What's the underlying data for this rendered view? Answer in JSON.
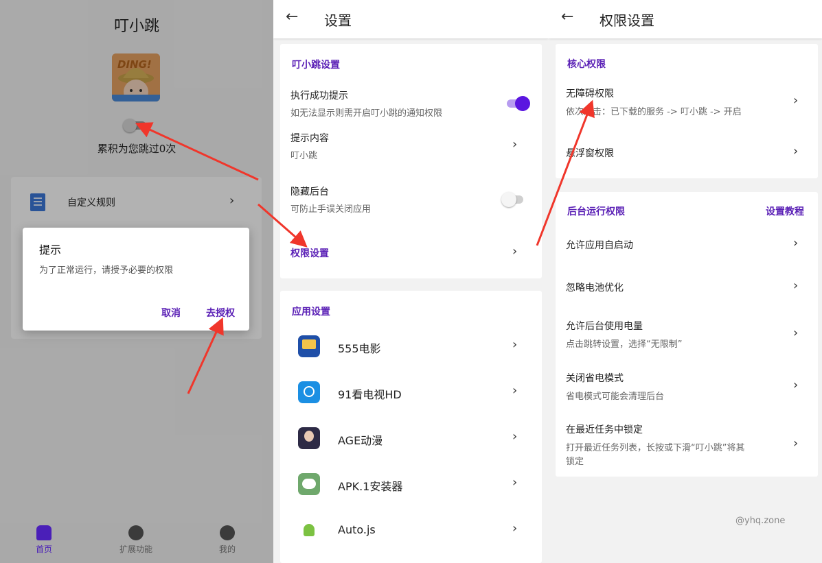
{
  "home": {
    "title": "叮小跳",
    "logo_text": "DING!",
    "skip_count_text": "累积为您跳过0次",
    "rules_label": "自定义规则",
    "dialog": {
      "title": "提示",
      "message": "为了正常运行，请授予必要的权限",
      "cancel": "取消",
      "confirm": "去授权"
    },
    "nav": [
      {
        "label": "首页",
        "icon": "home-icon",
        "active": true
      },
      {
        "label": "扩展功能",
        "icon": "compass-icon",
        "active": false
      },
      {
        "label": "我的",
        "icon": "person-icon",
        "active": false
      }
    ]
  },
  "settings": {
    "title": "设置",
    "section1": {
      "header": "叮小跳设置",
      "rows": [
        {
          "title": "执行成功提示",
          "subtitle": "如无法显示则需开启叮小跳的通知权限",
          "switch_on": true
        },
        {
          "title": "提示内容",
          "subtitle": "叮小跳"
        },
        {
          "title": "隐藏后台",
          "subtitle": "可防止手误关闭应用",
          "switch_on": false
        },
        {
          "title": "权限设置"
        }
      ]
    },
    "section2": {
      "header": "应用设置",
      "apps": [
        "555电影",
        "91看电视HD",
        "AGE动漫",
        "APK.1安装器",
        "Auto.js"
      ]
    }
  },
  "permissions": {
    "title": "权限设置",
    "core": {
      "header": "核心权限",
      "rows": [
        {
          "title": "无障碍权限",
          "subtitle": "依次点击：已下载的服务 -> 叮小跳 -> 开启"
        },
        {
          "title": "悬浮窗权限"
        }
      ]
    },
    "background": {
      "header": "后台运行权限",
      "tutorial_link": "设置教程",
      "rows": [
        {
          "title": "允许应用自启动"
        },
        {
          "title": "忽略电池优化"
        },
        {
          "title": "允许后台使用电量",
          "subtitle": "点击跳转设置，选择“无限制”"
        },
        {
          "title": "关闭省电模式",
          "subtitle": "省电模式可能会清理后台"
        },
        {
          "title": "在最近任务中锁定",
          "subtitle": "打开最近任务列表，长按或下滑“叮小跳”将其",
          "subtitle2": "锁定"
        }
      ]
    },
    "watermark": "@yhq.zone"
  },
  "colors": {
    "accent": "#5b21b6",
    "switch_on": "#5b16e0",
    "annotation_arrow": "#f0362b"
  }
}
